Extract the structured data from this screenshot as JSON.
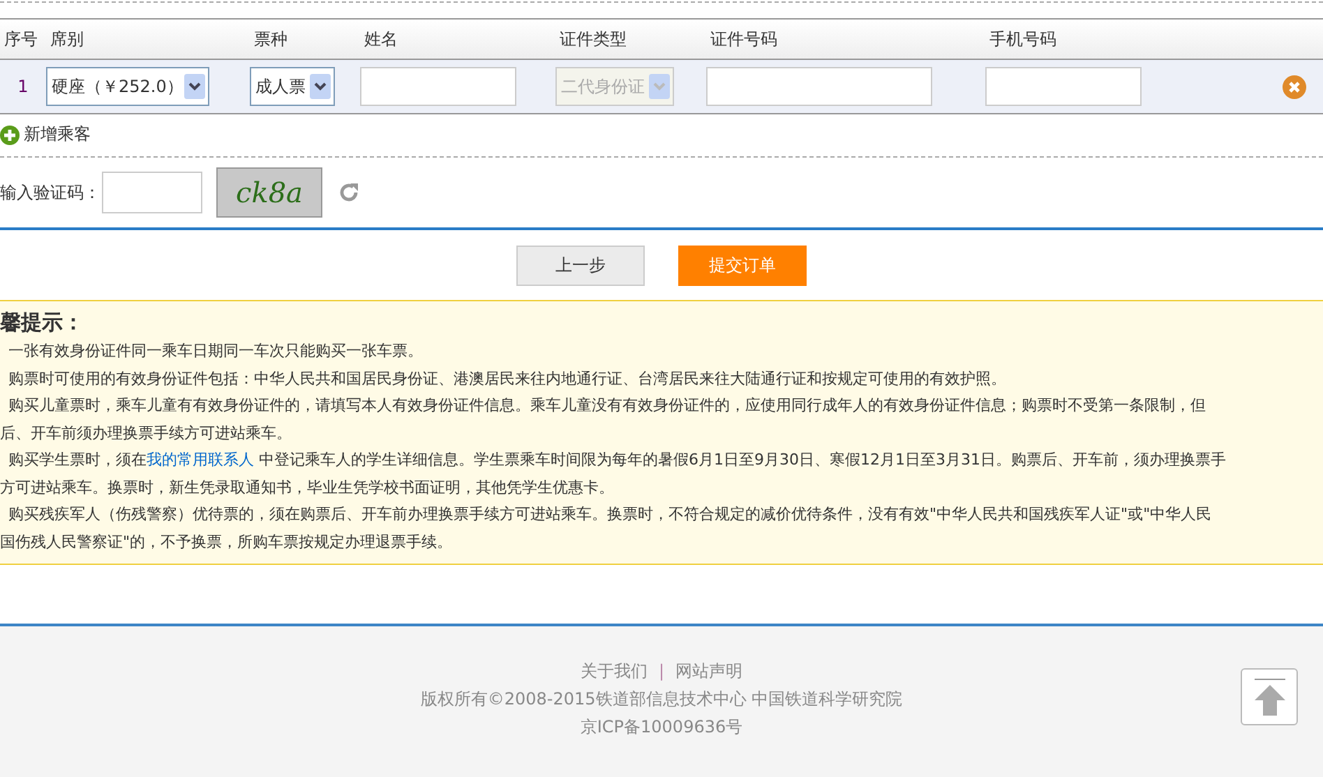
{
  "passenger_table": {
    "columns": [
      "序号",
      "席别",
      "票种",
      "姓名",
      "证件类型",
      "证件号码",
      "手机号码"
    ],
    "rows": [
      {
        "number": "1",
        "seat": "硬座（￥252.0）",
        "ticket_type": "成人票",
        "id_type": "二代身份证",
        "id_type_disabled": true
      }
    ]
  },
  "add_passenger": "新增乘客",
  "captcha": {
    "label": "输入验证码：",
    "image_text": "ck8a"
  },
  "buttons": [
    {
      "label": "上一步",
      "kind": "secondary"
    },
    {
      "label": "提交订单",
      "kind": "primary"
    }
  ],
  "tips": {
    "title": "馨提示：",
    "lines": [
      {
        "text": "一张有效身份证件同一乘车日期同一车次只能购买一张车票。",
        "continuation": false
      },
      {
        "text": "购票时可使用的有效身份证件包括：中华人民共和国居民身份证、港澳居民来往内地通行证、台湾居民来往大陆通行证和按规定可使用的有效护照。",
        "continuation": false
      },
      {
        "text": "购买儿童票时，乘车儿童有有效身份证件的，请填写本人有效身份证件信息。乘车儿童没有有效身份证件的，应使用同行成年人的有效身份证件信息；购票时不受第一条限制，但",
        "continuation": false
      },
      {
        "text": "后、开车前须办理换票手续方可进站乘车。",
        "continuation": true
      },
      {
        "text": "购买学生票时，须在",
        "continuation": false,
        "link": "我的常用联系人",
        "after": " 中登记乘车人的学生详细信息。学生票乘车时间限为每年的暑假6月1日至9月30日、寒假12月1日至3月31日。购票后、开车前，须办理换票手"
      },
      {
        "text": "方可进站乘车。换票时，新生凭录取通知书，毕业生凭学校书面证明，其他凭学生优惠卡。",
        "continuation": true
      },
      {
        "text": "购买残疾军人（伤残警察）优待票的，须在购票后、开车前办理换票手续方可进站乘车。换票时，不符合规定的减价优待条件，没有有效\"中华人民共和国残疾军人证\"或\"中华人民",
        "continuation": false
      },
      {
        "text": "国伤残人民警察证\"的，不予换票，所购车票按规定办理退票手续。",
        "continuation": true
      }
    ]
  },
  "footer": {
    "links": [
      "关于我们",
      "网站声明"
    ],
    "separator": "|",
    "copyright": "版权所有©2008-2015铁道部信息技术中心   中国铁道科学研究院",
    "icp": "京ICP备10009636号"
  }
}
